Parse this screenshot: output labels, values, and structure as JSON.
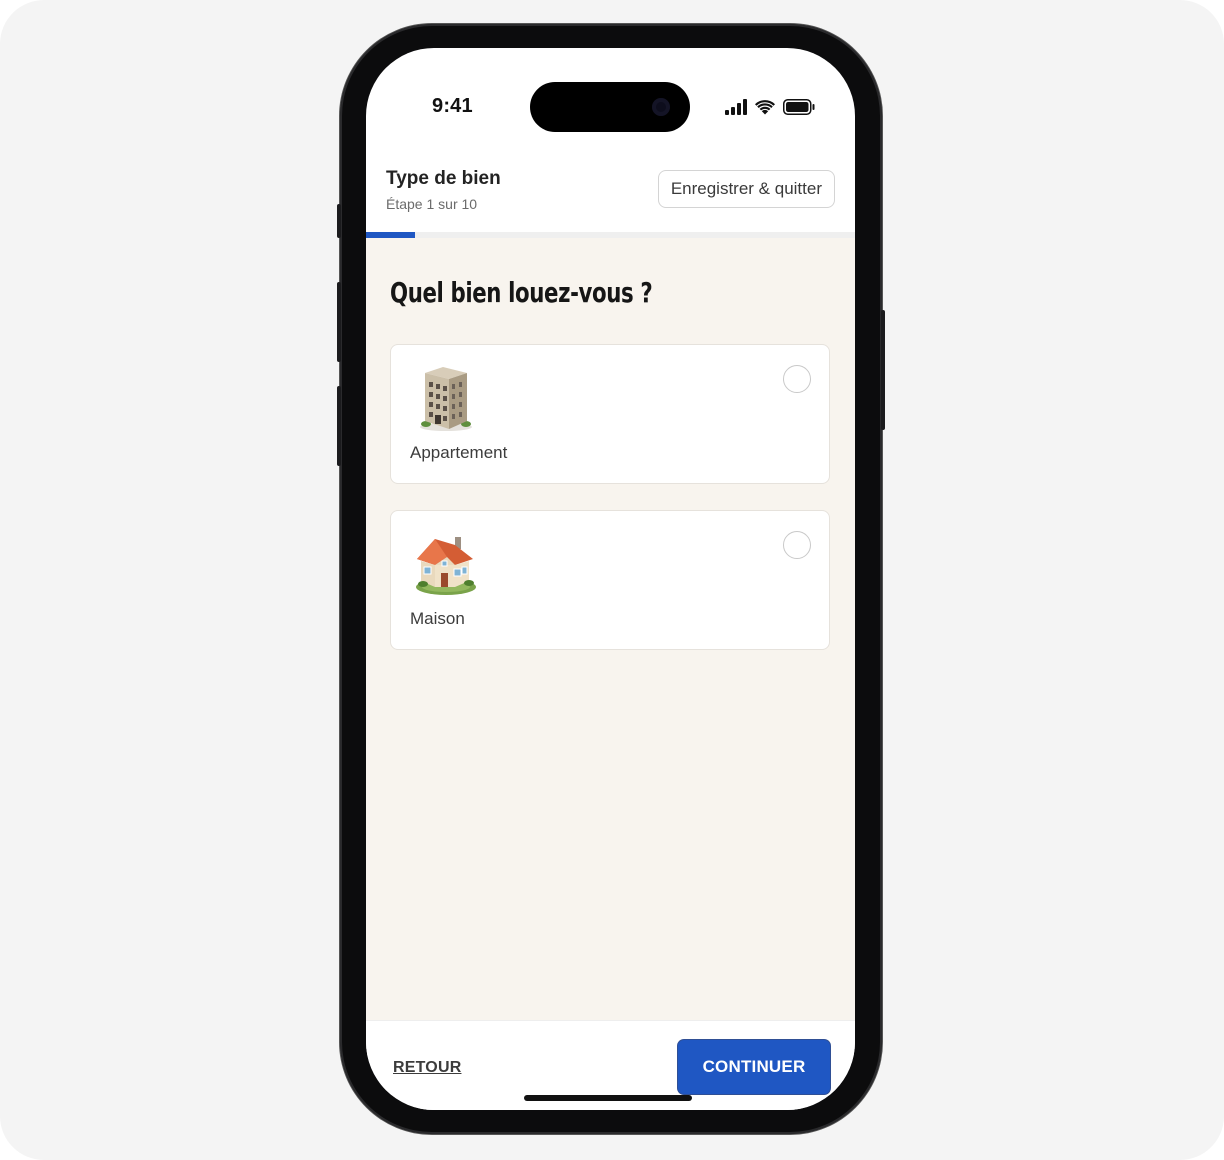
{
  "status_bar": {
    "time": "9:41",
    "icons": [
      "cellular-signal-icon",
      "wifi-icon",
      "battery-icon"
    ]
  },
  "header": {
    "title": "Type de bien",
    "step": "Étape 1 sur 10",
    "save_label": "Enregistrer & quitter"
  },
  "progress": {
    "current": 1,
    "total": 10,
    "fraction": 0.1
  },
  "question": "Quel bien louez-vous ?",
  "options": [
    {
      "label": "Appartement",
      "icon": "apartment-building-icon",
      "selected": false
    },
    {
      "label": "Maison",
      "icon": "house-icon",
      "selected": false
    }
  ],
  "footer": {
    "back_label": "RETOUR",
    "continue_label": "CONTINUER"
  },
  "colors": {
    "accent": "#1f57c3",
    "content_background": "#f8f4ee",
    "text_primary": "#232323"
  }
}
